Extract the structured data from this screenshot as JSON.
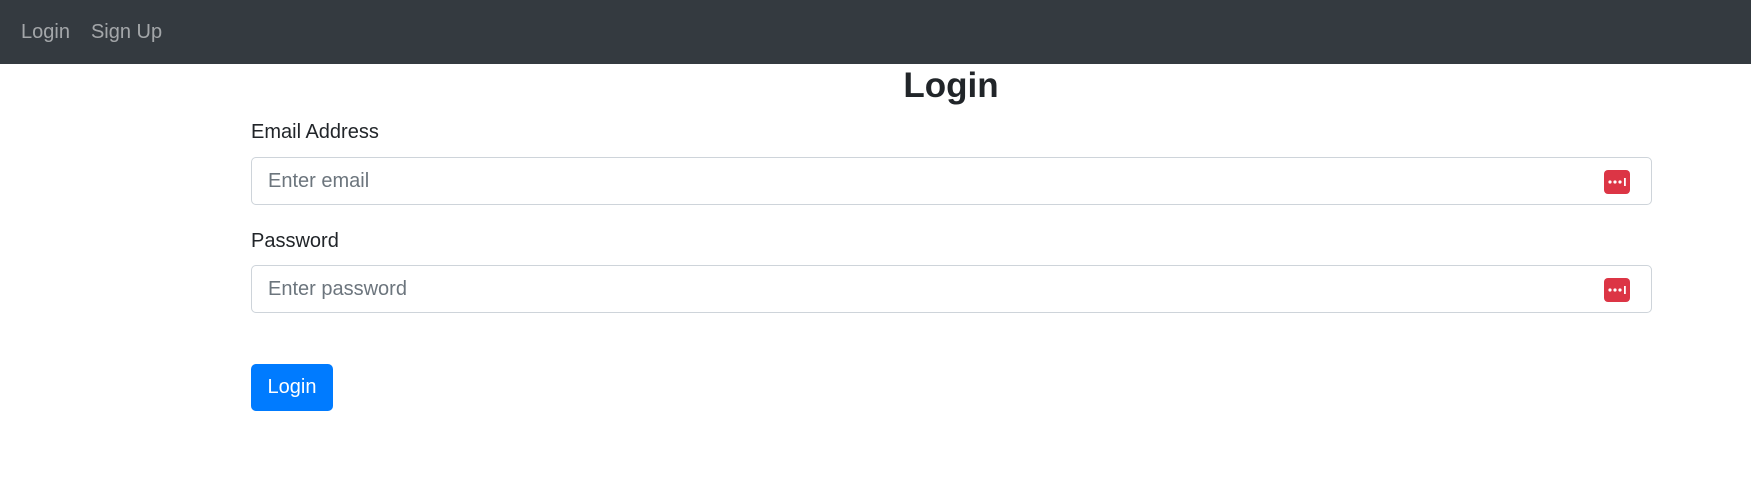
{
  "navbar": {
    "links": [
      {
        "label": "Login"
      },
      {
        "label": "Sign Up"
      }
    ],
    "background": "#343a40"
  },
  "page": {
    "title": "Login"
  },
  "form": {
    "email": {
      "label": "Email Address",
      "placeholder": "Enter email",
      "value": ""
    },
    "password": {
      "label": "Password",
      "placeholder": "Enter password",
      "value": ""
    },
    "submit_label": "Login",
    "accent_color": "#007bff",
    "password_manager_icon": "password-manager-icon",
    "password_manager_color": "#dc3545"
  }
}
